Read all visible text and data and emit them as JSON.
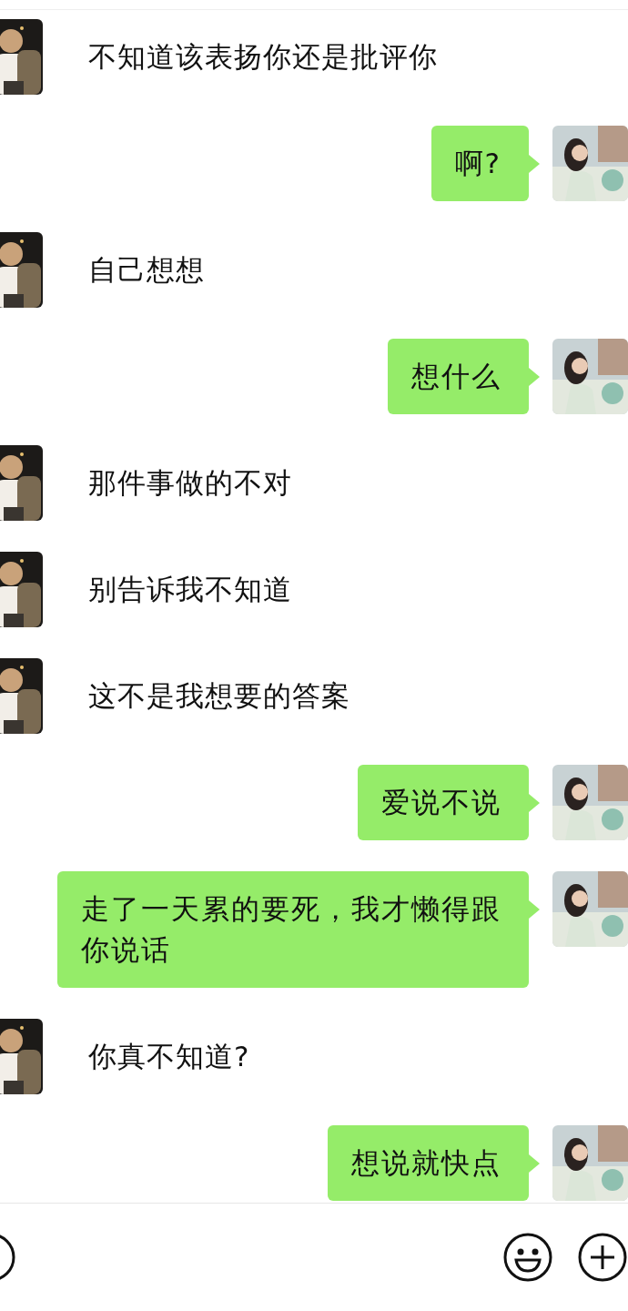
{
  "messages": [
    {
      "kind": "received",
      "text": "不知道该表扬你还是批评你"
    },
    {
      "kind": "sent",
      "text": "啊?"
    },
    {
      "kind": "received",
      "text": "自己想想"
    },
    {
      "kind": "sent",
      "text": "想什么"
    },
    {
      "kind": "received",
      "text": "那件事做的不对"
    },
    {
      "kind": "received",
      "text": "别告诉我不知道"
    },
    {
      "kind": "received",
      "text": "这不是我想要的答案"
    },
    {
      "kind": "sent",
      "text": "爱说不说"
    },
    {
      "kind": "sent",
      "text": "走了一天累的要死，我才懒得跟你说话"
    },
    {
      "kind": "received",
      "text": "你真不知道?"
    },
    {
      "kind": "sent",
      "text": "想说就快点"
    }
  ]
}
